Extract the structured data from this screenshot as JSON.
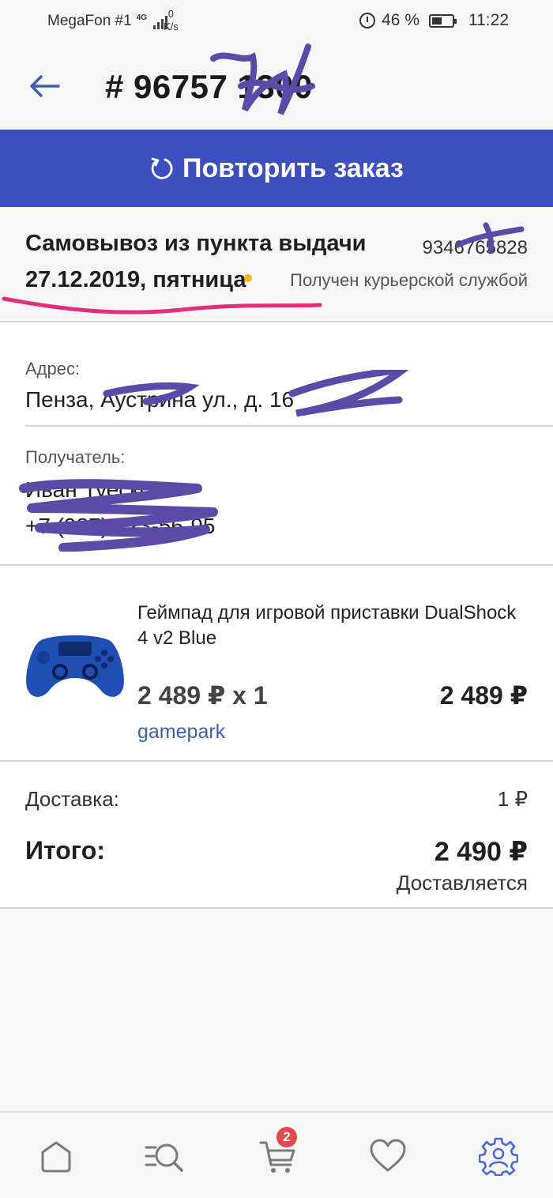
{
  "status_bar": {
    "carrier": "MegaFon #1",
    "network": "4G",
    "speed_value": "0",
    "speed_unit": "K/s",
    "battery": "46 %",
    "time": "11:22"
  },
  "header": {
    "order_number": "# 96757 1300"
  },
  "repeat_order": {
    "label": "Повторить заказ"
  },
  "delivery": {
    "method": "Самовывоз из пункта выдачи",
    "date": "27.12.2019, пятница",
    "tracking_number": "9346765828",
    "status": "Получен курьерской службой",
    "status_color": "#f2b21c"
  },
  "address": {
    "label": "Адрес:",
    "value": "Пенза, Аустрина ул., д. 16"
  },
  "recipient": {
    "label": "Получатель:",
    "name": "Иван Туесков",
    "phone": "+7 (987) 123-56-95"
  },
  "product": {
    "name": "Геймпад для игровой приставки DualShock 4 v2 Blue",
    "unit_price": "2 489 ₽ x 1",
    "total": "2 489 ₽",
    "seller": "gamepark"
  },
  "summary": {
    "delivery_label": "Доставка:",
    "delivery_value": "1 ₽",
    "total_label": "Итого:",
    "total_value": "2 490 ₽",
    "order_status": "Доставляется"
  },
  "nav": {
    "items": [
      "home-icon",
      "catalog-search-icon",
      "cart-icon",
      "heart-icon",
      "settings-icon"
    ],
    "cart_count": "2",
    "active_color": "#4c67d6"
  },
  "colors": {
    "accent": "#3d4fbf",
    "link": "#3d5fa8",
    "scribble": "#5b4aa8",
    "highlight": "#e0307a"
  }
}
